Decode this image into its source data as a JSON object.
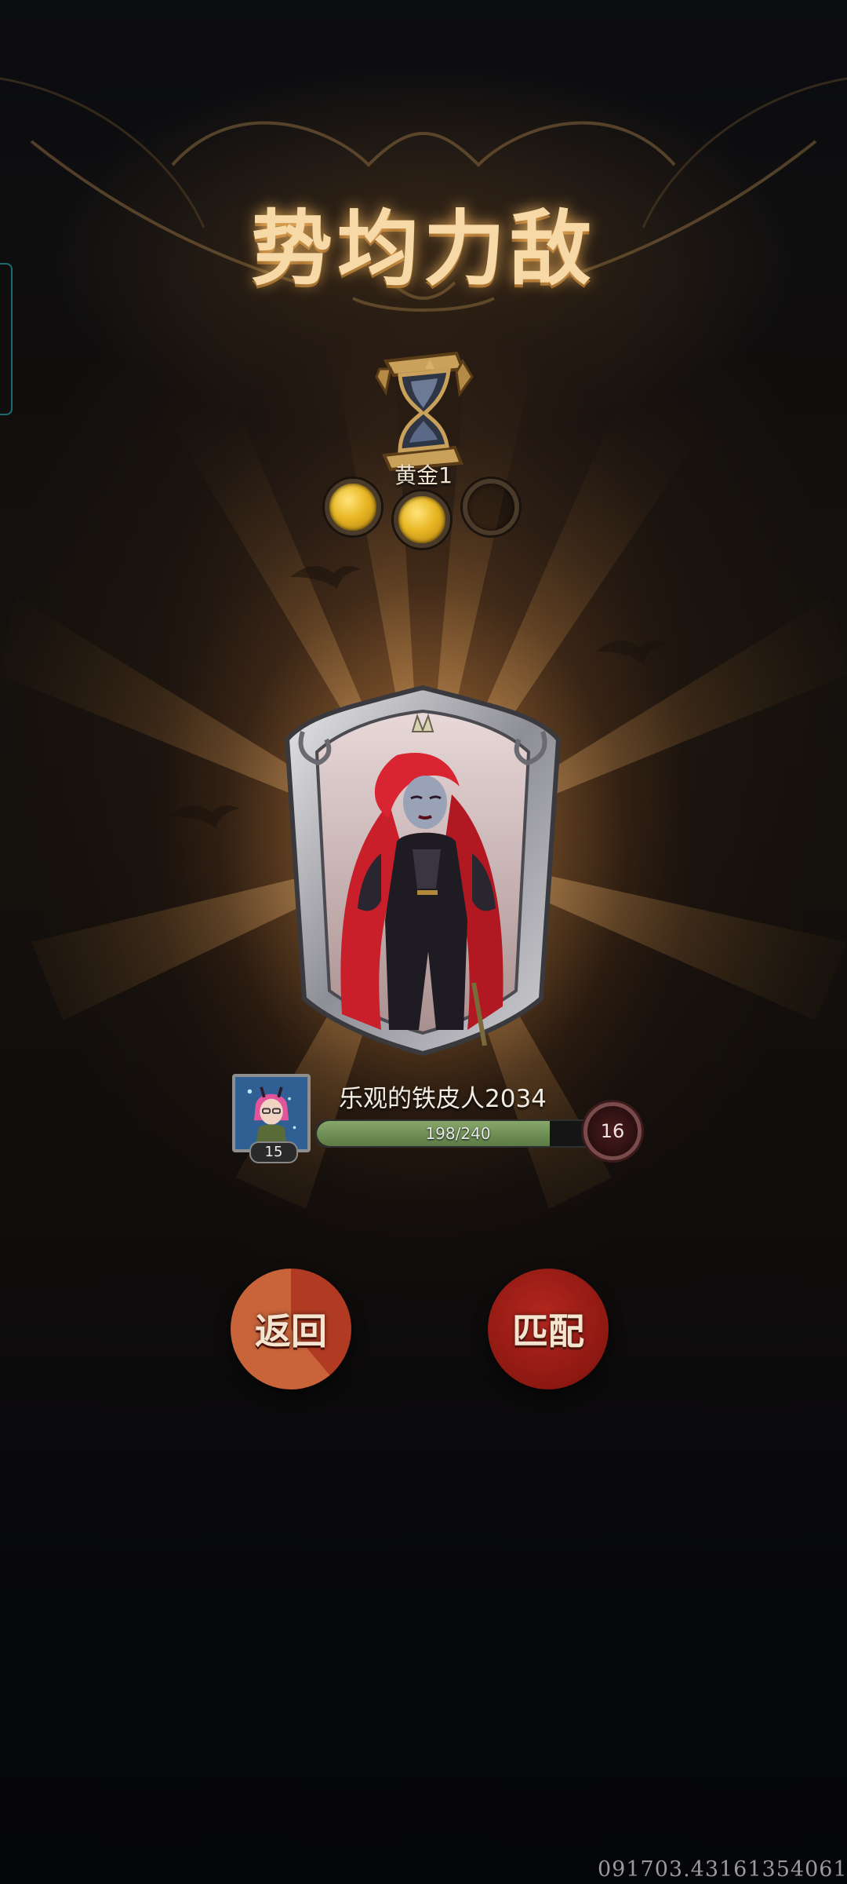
{
  "title": "势均力敌",
  "rank": {
    "name": "黄金1",
    "icon": "hourglass-icon",
    "pips_filled": 2,
    "pips_total": 3
  },
  "hero": {
    "icon": "hero-portrait-red-haired-queen"
  },
  "player": {
    "name": "乐观的铁皮人2034",
    "avatar_level": "15",
    "xp_text": "198/240",
    "xp_current": 198,
    "xp_max": 240,
    "account_level": "16"
  },
  "buttons": {
    "back_label": "返回",
    "match_label": "匹配"
  },
  "watermark": "091703.43161354061",
  "colors": {
    "title_gold": "#f6d9a6",
    "coin_gold": "#e8b623",
    "xp_green": "#6f8f55",
    "button_red": "#a82418",
    "button_orange": "#c8633a"
  }
}
